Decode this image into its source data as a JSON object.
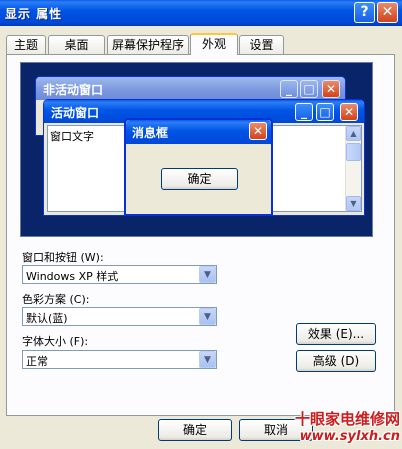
{
  "window": {
    "title": "显示 属性",
    "help_glyph": "?",
    "close_glyph": "✕"
  },
  "tabs": [
    {
      "label": "主题",
      "active": false
    },
    {
      "label": "桌面",
      "active": false
    },
    {
      "label": "屏幕保护程序",
      "active": false
    },
    {
      "label": "外观",
      "active": true
    },
    {
      "label": "设置",
      "active": false
    }
  ],
  "preview": {
    "inactive_window_title": "非活动窗口",
    "active_window_title": "活动窗口",
    "window_text": "窗口文字",
    "message_box_title": "消息框",
    "ok_label": "确定",
    "minimize_glyph": "_",
    "maximize_glyph": "□",
    "close_glyph": "✕"
  },
  "form": {
    "style_label": "窗口和按钮 (W):",
    "style_value": "Windows XP 样式",
    "color_label": "色彩方案 (C):",
    "color_value": "默认(蓝)",
    "font_label": "字体大小 (F):",
    "font_value": "正常",
    "effects_button": "效果 (E)...",
    "advanced_button": "高级 (D)"
  },
  "footer": {
    "ok_button": "确定",
    "cancel_button": "取消"
  },
  "watermark": {
    "line1": "十眼家电维修网",
    "line2": "www.sylxh.cn"
  },
  "colors": {
    "titlebar": "#0055e5",
    "desktop_preview": "#0a246a",
    "face": "#ece9d8",
    "watermark": "#cc1e1e"
  }
}
